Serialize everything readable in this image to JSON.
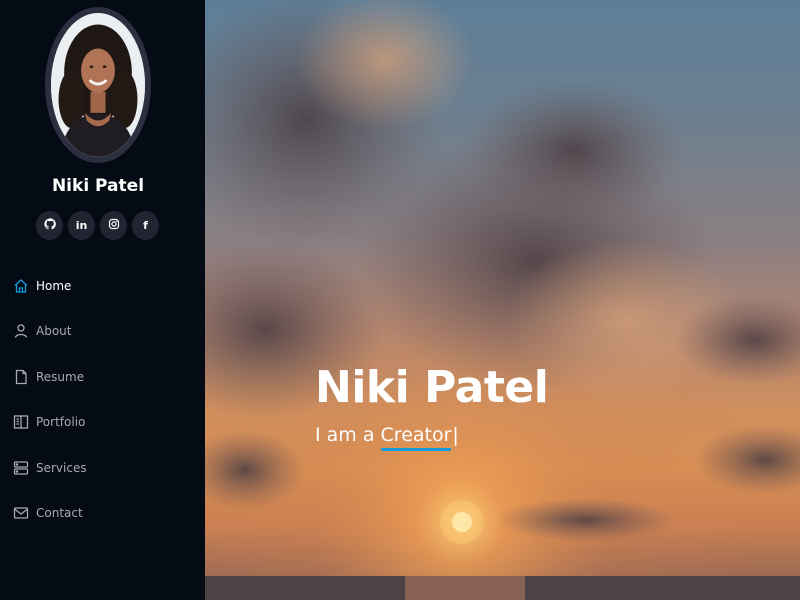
{
  "profile": {
    "name": "Niki Patel"
  },
  "social": [
    {
      "name": "github",
      "label": ""
    },
    {
      "name": "linkedin",
      "label": "in"
    },
    {
      "name": "instagram",
      "label": ""
    },
    {
      "name": "facebook",
      "label": "f"
    }
  ],
  "nav": {
    "items": [
      {
        "label": "Home",
        "icon": "home-icon",
        "active": true
      },
      {
        "label": "About",
        "icon": "person-icon",
        "active": false
      },
      {
        "label": "Resume",
        "icon": "file-icon",
        "active": false
      },
      {
        "label": "Portfolio",
        "icon": "book-icon",
        "active": false
      },
      {
        "label": "Services",
        "icon": "server-icon",
        "active": false
      },
      {
        "label": "Contact",
        "icon": "envelope-icon",
        "active": false
      }
    ]
  },
  "hero": {
    "title": "Niki Patel",
    "prefix": "I am a ",
    "typed": "Creator",
    "cursor": "|"
  },
  "colors": {
    "accent": "#149ddd",
    "sidebar_bg": "#040b14",
    "nav_text": "#a8a9b4"
  }
}
